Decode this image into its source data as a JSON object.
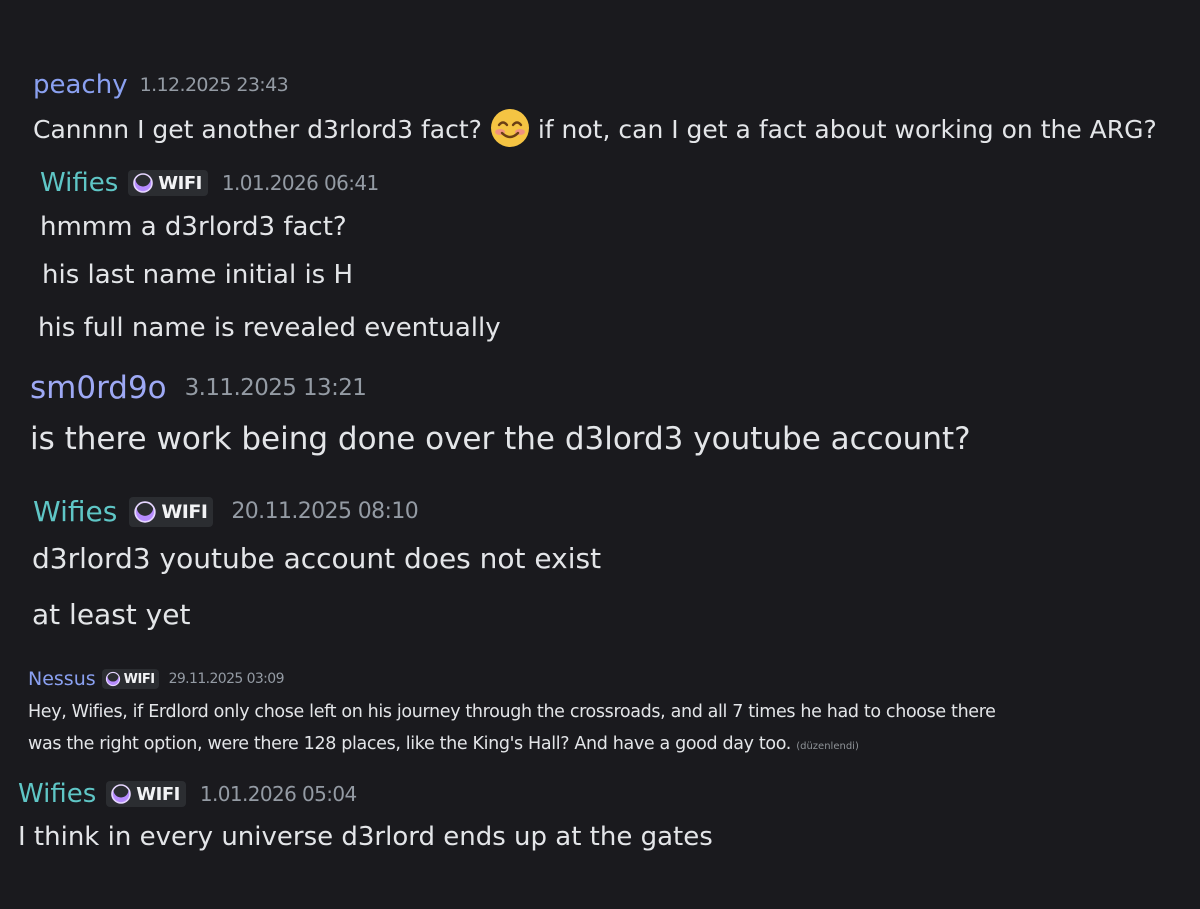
{
  "messages": [
    {
      "author": "peachy",
      "author_color": "#8aa0f0",
      "badge": "",
      "timestamp": "1.12.2025 23:43",
      "lines": [
        {
          "text": "Cannnn I get another d3rlord3 fact?",
          "emoji": "smiling-face-with-smiling-eyes",
          "text_after": "if not, can I get a fact about working on the ARG?"
        }
      ]
    },
    {
      "author": "Wifies",
      "author_color": "#5fc6c6",
      "badge": "WIFI",
      "timestamp": "1.01.2026 06:41",
      "lines": [
        {
          "text": "hmmm a d3rlord3 fact?"
        },
        {
          "text": "his last name initial is H"
        },
        {
          "text": "his full name is revealed eventually"
        }
      ]
    },
    {
      "author": "sm0rd9o",
      "author_color": "#9ea9f5",
      "badge": "",
      "timestamp": "3.11.2025 13:21",
      "lines": [
        {
          "text": "is there work being done over the d3lord3 youtube account?"
        }
      ]
    },
    {
      "author": "Wifies",
      "author_color": "#5fc6c6",
      "badge": "WIFI",
      "timestamp": "20.11.2025 08:10",
      "lines": [
        {
          "text": "d3rlord3 youtube account does not exist"
        },
        {
          "text": "at least yet"
        }
      ]
    },
    {
      "author": "Nessus",
      "author_color": "#8aa0f0",
      "badge": "WIFI",
      "timestamp": "29.11.2025 03:09",
      "lines": [
        {
          "text": "Hey, Wifies, if Erdlord only chose left on his journey through the crossroads, and all 7 times he had to choose there"
        },
        {
          "text": "was the right option, were there 128 places, like the King's Hall? And have a good day too.",
          "edited": "(düzenlendi)"
        }
      ]
    },
    {
      "author": "Wifies",
      "author_color": "#5fc6c6",
      "badge": "WIFI",
      "timestamp": "1.01.2026 05:04",
      "lines": [
        {
          "text": "I think in every universe d3rlord ends up at the gates"
        }
      ]
    }
  ],
  "badge_icon": "guild-tag-moon-icon",
  "colors": {
    "background": "#1a1a1e",
    "badge_bg": "#2b2d31",
    "timestamp": "#949ba4",
    "message_text": "#e3e5e8",
    "badge_icon": "#b78cff"
  }
}
